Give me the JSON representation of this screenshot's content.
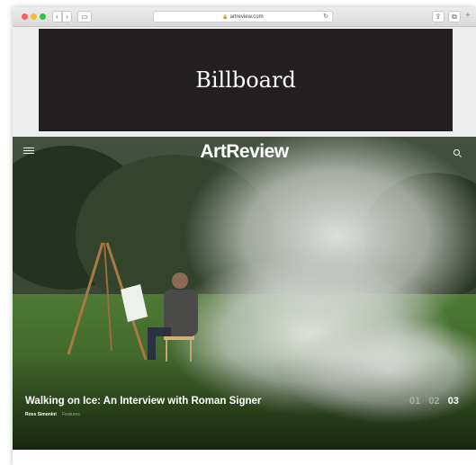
{
  "browser": {
    "url": "artreview.com",
    "icons": {
      "back": "chevron-left-icon",
      "forward": "chevron-right-icon",
      "sidebar": "sidebar-icon",
      "reload": "reload-icon",
      "share": "share-icon",
      "tabs": "tabs-icon",
      "new_tab": "plus-icon"
    }
  },
  "ad": {
    "label": "Billboard",
    "background": "#231f20"
  },
  "header": {
    "logo": "ArtReview",
    "icons": {
      "menu": "hamburger-icon",
      "search": "search-icon"
    }
  },
  "hero": {
    "headline": "Walking on Ice: An Interview with Roman Signer",
    "author": "Ross Simonini",
    "section": "Features",
    "pages": [
      {
        "label": "01",
        "active": false
      },
      {
        "label": "02",
        "active": false
      },
      {
        "label": "03",
        "active": true
      }
    ]
  }
}
